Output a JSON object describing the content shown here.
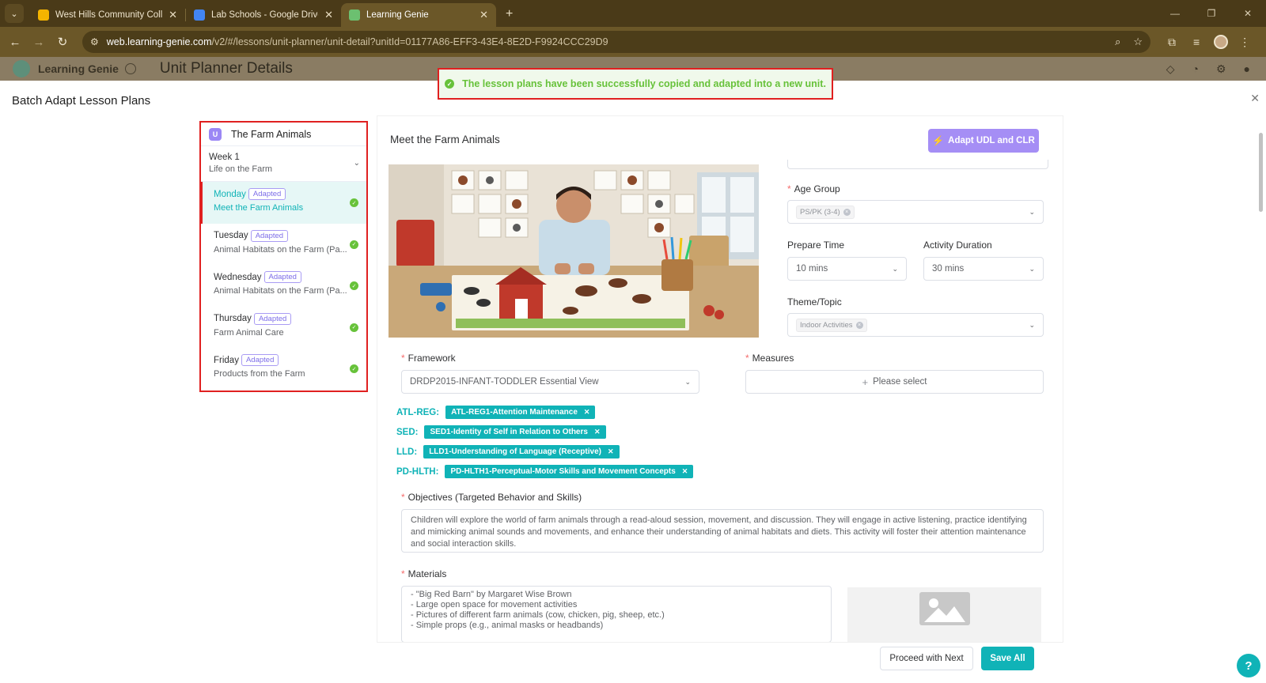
{
  "browser": {
    "tabs": [
      {
        "label": "West Hills Community College",
        "color": "#f4b400"
      },
      {
        "label": "Lab Schools - Google Drive",
        "color": "#4285f4"
      },
      {
        "label": "Learning Genie",
        "color": "#6cc070"
      }
    ],
    "url_host": "web.learning-genie.com",
    "url_path": "/v2/#/lessons/unit-planner/unit-detail?unitId=01177A86-EFF3-43E4-8E2D-F9924CCC29D9"
  },
  "app": {
    "brand": "Learning Genie",
    "page_title": "Unit Planner Details"
  },
  "dialog": {
    "title": "Batch Adapt Lesson Plans"
  },
  "toast": {
    "message": "The lesson plans have been successfully copied and adapted into a new unit."
  },
  "unit": {
    "icon_letter": "U",
    "title": "The Farm Animals",
    "week": {
      "label": "Week 1",
      "theme": "Life on the Farm"
    },
    "days": [
      {
        "day": "Monday",
        "badge": "Adapted",
        "lesson": "Meet the Farm Animals"
      },
      {
        "day": "Tuesday",
        "badge": "Adapted",
        "lesson": "Animal Habitats on the Farm (Pa..."
      },
      {
        "day": "Wednesday",
        "badge": "Adapted",
        "lesson": "Animal Habitats on the Farm (Pa..."
      },
      {
        "day": "Thursday",
        "badge": "Adapted",
        "lesson": "Farm Animal Care"
      },
      {
        "day": "Friday",
        "badge": "Adapted",
        "lesson": "Products from the Farm"
      }
    ]
  },
  "lesson": {
    "title": "Meet the Farm Animals",
    "adapt_button": "Adapt UDL and CLR",
    "age_group": {
      "label": "Age Group",
      "value": "PS/PK (3-4)"
    },
    "prepare_time": {
      "label": "Prepare Time",
      "value": "10 mins"
    },
    "activity_duration": {
      "label": "Activity Duration",
      "value": "30 mins"
    },
    "theme": {
      "label": "Theme/Topic",
      "value": "Indoor Activities"
    },
    "framework": {
      "label": "Framework",
      "value": "DRDP2015-INFANT-TODDLER Essential View"
    },
    "measures": {
      "label": "Measures",
      "placeholder": "Please select"
    },
    "domains": [
      {
        "code": "ATL-REG:",
        "tag": "ATL-REG1-Attention Maintenance"
      },
      {
        "code": "SED:",
        "tag": "SED1-Identity of Self in Relation to Others"
      },
      {
        "code": "LLD:",
        "tag": "LLD1-Understanding of Language (Receptive)"
      },
      {
        "code": "PD-HLTH:",
        "tag": "PD-HLTH1-Perceptual-Motor Skills and Movement Concepts"
      }
    ],
    "objectives": {
      "label": "Objectives (Targeted Behavior and Skills)",
      "text": "Children will explore the world of farm animals through a read-aloud session, movement, and discussion. They will engage in active listening, practice identifying and mimicking animal sounds and movements, and enhance their understanding of animal habitats and diets. This activity will foster their attention maintenance and social interaction skills."
    },
    "materials": {
      "label": "Materials",
      "text": "- \"Big Red Barn\" by Margaret Wise Brown\n- Large open space for movement activities\n- Pictures of different farm animals (cow, chicken, pig, sheep, etc.)\n- Simple props (e.g., animal masks or headbands)"
    }
  },
  "footer": {
    "proceed": "Proceed with Next",
    "save": "Save All",
    "help": "?"
  },
  "colors": {
    "accent": "#10b3b7",
    "purple": "#a58ef5",
    "success": "#67c23a",
    "highlight": "#e02020"
  }
}
